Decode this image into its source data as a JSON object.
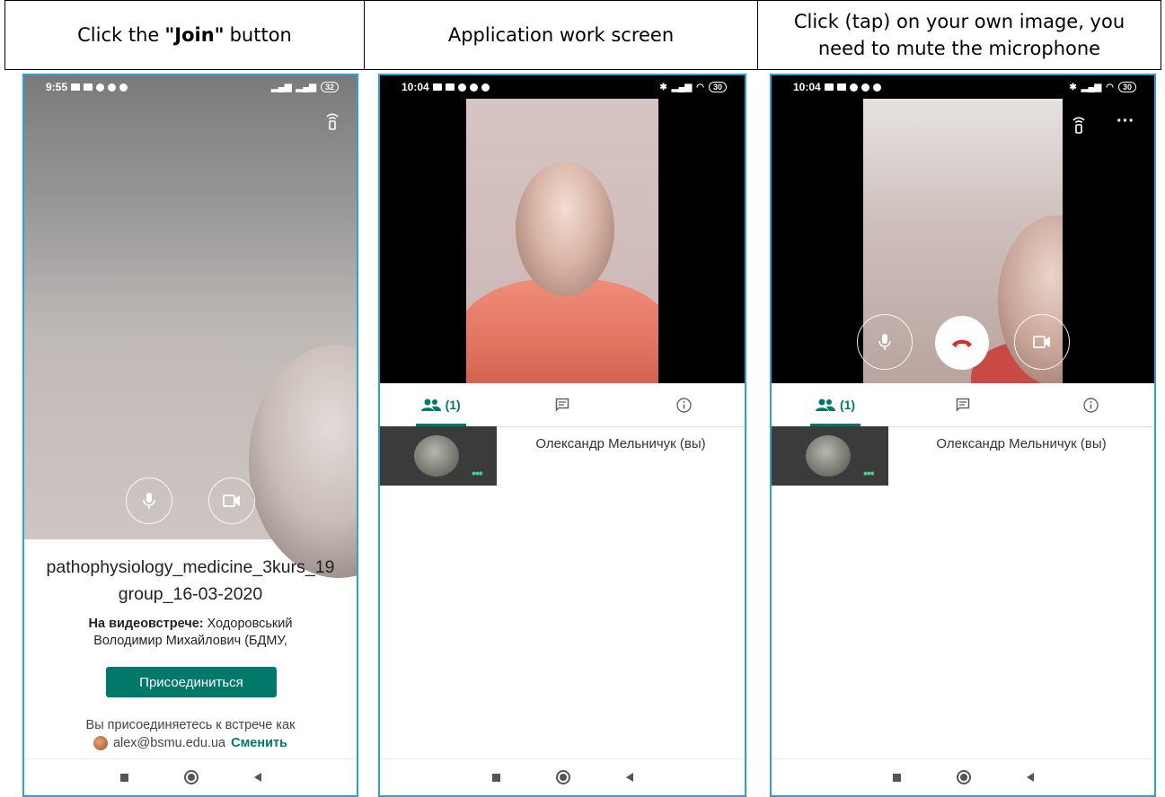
{
  "headers": {
    "col1_prefix": "Click the",
    "col1_bold": "\"Join\"",
    "col1_suffix": "button",
    "col2": "Application work screen",
    "col3_line1": "Click (tap) on your own image, you",
    "col3_line2": "need to mute the microphone"
  },
  "phone1": {
    "time": "9:55",
    "battery": "32",
    "meeting_name_line1": "pathophysiology_medicine_3kurs_19",
    "meeting_name_line2": "group_16-03-2020",
    "on_call_label": "На видеовстрече:",
    "on_call_names_line1": "Ходоровський",
    "on_call_names_line2": "Володимир Михайлович (БДМУ,",
    "join_button": "Присоединиться",
    "joining_as": "Вы присоединяетесь к встрече как",
    "account_email": "alex@bsmu.edu.ua",
    "change_link": "Сменить"
  },
  "phone2": {
    "time": "10:04",
    "battery": "30",
    "people_tab": "(1)",
    "participant_name": "Олександр Мельничук (вы)"
  },
  "phone3": {
    "time": "10:04",
    "battery": "30",
    "people_tab": "(1)",
    "participant_name": "Олександр Мельничук (вы)",
    "more_menu": "···"
  },
  "colors": {
    "accent": "#00796b",
    "border": "#29a3dd",
    "end_call": "#d93025"
  },
  "icons": [
    "cast-icon",
    "mic-icon",
    "camera-icon",
    "end-call-icon",
    "people-icon",
    "chat-icon",
    "info-icon",
    "more-icon"
  ]
}
